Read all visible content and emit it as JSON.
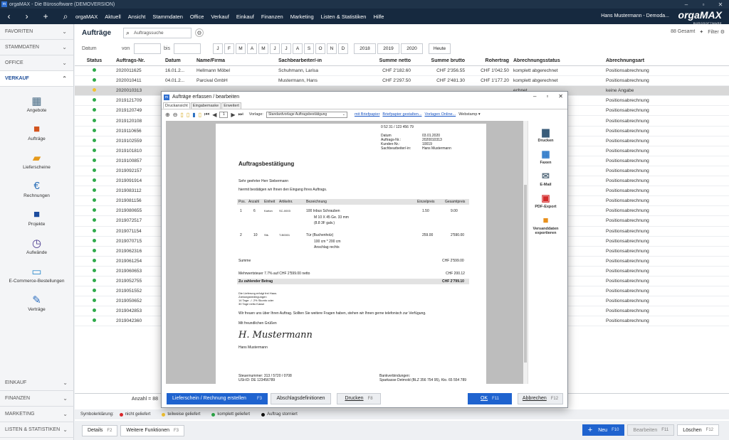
{
  "app": {
    "title": "orgaMAX - Die Bürosoftware (DEMOVERSION)",
    "logo_text": "orgaMAX",
    "logo_sub": "BÜROSOFTWARE",
    "user": "Hans Mustermann - Demoda..."
  },
  "menu": [
    "orgaMAX",
    "Aktuell",
    "Ansicht",
    "Stammdaten",
    "Office",
    "Verkauf",
    "Einkauf",
    "Finanzen",
    "Marketing",
    "Listen & Statistiken",
    "Hilfe"
  ],
  "sidebar": {
    "top_sections": [
      {
        "label": "FAVORITEN"
      },
      {
        "label": "STAMMDATEN"
      },
      {
        "label": "OFFICE"
      }
    ],
    "verkauf": "VERKAUF",
    "items": [
      {
        "label": "Angebote",
        "icon": "calculator-icon",
        "glyph": "▦",
        "color": "#4a6d86"
      },
      {
        "label": "Aufträge",
        "icon": "briefcase-icon",
        "glyph": "■",
        "color": "#d2541e"
      },
      {
        "label": "Lieferscheine",
        "icon": "truck-icon",
        "glyph": "▰",
        "color": "#e59a1c"
      },
      {
        "label": "Rechnungen",
        "icon": "invoice-icon",
        "glyph": "€",
        "color": "#2a6fb8"
      },
      {
        "label": "Projekte",
        "icon": "folder-icon",
        "glyph": "■",
        "color": "#1c4c9e"
      },
      {
        "label": "Aufwände",
        "icon": "clock-icon",
        "glyph": "◷",
        "color": "#4a3a8f"
      },
      {
        "label": "E-Commerce-Bestellungen",
        "icon": "laptop-icon",
        "glyph": "▭",
        "color": "#2c8acb"
      },
      {
        "label": "Verträge",
        "icon": "contract-icon",
        "glyph": "✎",
        "color": "#2f70c0"
      }
    ],
    "bottom_sections": [
      {
        "label": "EINKAUF"
      },
      {
        "label": "FINANZEN"
      },
      {
        "label": "MARKETING"
      },
      {
        "label": "LISTEN & STATISTIKEN"
      }
    ]
  },
  "main": {
    "title": "Aufträge",
    "search_placeholder": "Auftragssuche",
    "total": "88 Gesamt",
    "filter": "Filter",
    "date_label": "Datum",
    "from": "von",
    "to": "bis",
    "months": [
      "J",
      "F",
      "M",
      "A",
      "M",
      "J",
      "J",
      "A",
      "S",
      "O",
      "N",
      "D"
    ],
    "years": [
      "2018",
      "2019",
      "2020"
    ],
    "today": "Heute",
    "columns": [
      "Status",
      "Auftrags-Nr.",
      "Datum",
      "Name/Firma",
      "Sachbearbeiter/-in",
      "Summe netto",
      "Summe brutto",
      "Rohertrag",
      "Abrechnungsstatus",
      "Abrechnungsart"
    ],
    "rows": [
      {
        "status": "#2eaa4a",
        "nr": "2020011625",
        "datum": "16.01.2...",
        "name": "Hellmann Möbel",
        "sb": "Schuhmann, Larisa",
        "netto": "CHF 2'182.60",
        "brutto": "CHF 2'356.55",
        "roh": "CHF 1'042.50",
        "astatus": "komplett abgerechnet",
        "art": "Positionsabrechnung"
      },
      {
        "status": "#2eaa4a",
        "nr": "2020010411",
        "datum": "04.01.2...",
        "name": "Parcival GmbH",
        "sb": "Mustermann, Hans",
        "netto": "CHF 2'297.50",
        "brutto": "CHF 2'481.30",
        "roh": "CHF 1'177.20",
        "astatus": "komplett abgerechnet",
        "art": "Positionsabrechnung"
      },
      {
        "status": "#f2c230",
        "nr": "2020010313",
        "datum": "",
        "name": "",
        "sb": "",
        "netto": "",
        "brutto": "",
        "roh": "",
        "astatus": "echnet",
        "art": "keine Angabe"
      },
      {
        "status": "#2eaa4a",
        "nr": "2019121709",
        "astatus": "echnet",
        "art": "Positionsabrechnung"
      },
      {
        "status": "#2eaa4a",
        "nr": "2019120749",
        "astatus": "echnet",
        "art": "Positionsabrechnung"
      },
      {
        "status": "#2eaa4a",
        "nr": "2019120108",
        "astatus": "echnet",
        "art": "Positionsabrechnung"
      },
      {
        "status": "#2eaa4a",
        "nr": "2019110656",
        "astatus": "echnet",
        "art": "Positionsabrechnung"
      },
      {
        "status": "#2eaa4a",
        "nr": "2019102559",
        "astatus": "echnet",
        "art": "Positionsabrechnung"
      },
      {
        "status": "#2eaa4a",
        "nr": "2019101810",
        "astatus": "echnet",
        "art": "Positionsabrechnung"
      },
      {
        "status": "#2eaa4a",
        "nr": "2019100857",
        "astatus": "echnet",
        "art": "Positionsabrechnung"
      },
      {
        "status": "#2eaa4a",
        "nr": "2019092157",
        "astatus": "echnet",
        "art": "Positionsabrechnung"
      },
      {
        "status": "#2eaa4a",
        "nr": "2019091914",
        "astatus": "echnet",
        "art": "Positionsabrechnung"
      },
      {
        "status": "#2eaa4a",
        "nr": "2019083112",
        "astatus": "echnet",
        "art": "Positionsabrechnung"
      },
      {
        "status": "#2eaa4a",
        "nr": "2019081156",
        "astatus": "echnet",
        "art": "Positionsabrechnung"
      },
      {
        "status": "#2eaa4a",
        "nr": "2019080655",
        "astatus": "echnet",
        "art": "Positionsabrechnung"
      },
      {
        "status": "#2eaa4a",
        "nr": "2019072517",
        "astatus": "echnet",
        "art": "Positionsabrechnung"
      },
      {
        "status": "#2eaa4a",
        "nr": "2019071154",
        "astatus": "echnet",
        "art": "Positionsabrechnung"
      },
      {
        "status": "#2eaa4a",
        "nr": "2019070715",
        "astatus": "echnet",
        "art": "Positionsabrechnung"
      },
      {
        "status": "#2eaa4a",
        "nr": "2019062316",
        "astatus": "echnet",
        "art": "Positionsabrechnung"
      },
      {
        "status": "#2eaa4a",
        "nr": "2019061254",
        "astatus": "echnet",
        "art": "Positionsabrechnung"
      },
      {
        "status": "#2eaa4a",
        "nr": "2019060653",
        "astatus": "echnet",
        "art": "Positionsabrechnung"
      },
      {
        "status": "#2eaa4a",
        "nr": "2019052755",
        "astatus": "echnet",
        "art": "Positionsabrechnung"
      },
      {
        "status": "#2eaa4a",
        "nr": "2019051552",
        "astatus": "echnet",
        "art": "Positionsabrechnung"
      },
      {
        "status": "#2eaa4a",
        "nr": "2019050652",
        "astatus": "echnet",
        "art": "Positionsabrechnung"
      },
      {
        "status": "#2eaa4a",
        "nr": "2019042853",
        "astatus": "echnet",
        "art": "Positionsabrechnung"
      },
      {
        "status": "#2eaa4a",
        "nr": "2019042360",
        "astatus": "echnet",
        "art": "Positionsabrechnung"
      }
    ],
    "anzahl": "Anzahl = 88"
  },
  "symbols": {
    "label": "Symbolerklärung:",
    "items": [
      {
        "color": "#d8262a",
        "text": "nicht geliefert"
      },
      {
        "color": "#f2c230",
        "text": "teilweise geliefert"
      },
      {
        "color": "#2eaa4a",
        "text": "komplett geliefert"
      },
      {
        "color": "#111111",
        "text": "Auftrag storniert"
      }
    ]
  },
  "footer": {
    "details": "Details",
    "details_key": "F2",
    "weitere": "Weitere Funktionen",
    "weitere_key": "F3",
    "neu": "Neu",
    "neu_key": "F10",
    "bearbeiten": "Bearbeiten",
    "bearbeiten_key": "F11",
    "loeschen": "Löschen",
    "loeschen_key": "F12"
  },
  "dialog": {
    "title": "Aufträge erfassen / bearbeiten",
    "tabs": [
      "Druckansicht",
      "Eingabemaske",
      "Erweitert"
    ],
    "page_num": "1",
    "vorlage_label": "Vorlage:",
    "vorlage_value": "Standardvorlage Auftragsbestätigung",
    "links": [
      "mit Briefpapier",
      "Briefpapier gestalten...",
      "Vorlagen Online..."
    ],
    "webstamp": "Webstamp",
    "actions": [
      {
        "label": "Drucken",
        "icon": "printer-icon",
        "glyph": "▆",
        "color": "#3a5d7a"
      },
      {
        "label": "Faxen",
        "icon": "fax-icon",
        "glyph": "▦",
        "color": "#2b78c8"
      },
      {
        "label": "E-Mail",
        "icon": "mail-icon",
        "glyph": "✉",
        "color": "#5a6f80"
      },
      {
        "label": "PDF-Export",
        "icon": "pdf-icon",
        "glyph": "▣",
        "color": "#d32a2a"
      },
      {
        "label": "Versanddaten exportieren",
        "icon": "export-icon",
        "glyph": "■",
        "color": "#e8901c"
      }
    ],
    "buttons": {
      "lieferschein": "Lieferschein / Rechnung erstellen",
      "lieferschein_key": "F3",
      "abschlag": "Abschlagsdefinitionen",
      "drucken": "Drucken",
      "drucken_key": "F8",
      "ok": "OK",
      "ok_key": "F11",
      "abbrechen": "Abbrechen",
      "abbrechen_key": "F12"
    }
  },
  "doc": {
    "phone": "0 52 31 / 123 456 79",
    "meta": [
      [
        "Datum",
        "03.01.2020"
      ],
      [
        "Auftrags-Nr.:",
        "2020010313"
      ],
      [
        "Kunden-Nr.:",
        "10019"
      ],
      [
        "Sachbearbeiter/-in:",
        "Hans Mustermann"
      ]
    ],
    "heading": "Auftragsbestätigung",
    "salutation": "Sehr geehrter Herr Siebermann",
    "intro": "hiermit bestätigen wir Ihnen den Eingang Ihres Auftrags.",
    "cols": [
      "Pos.",
      "Anzahl",
      "Einheit",
      "Artikelnr.",
      "Bezeichnung",
      "Einzelpreis",
      "Gesamtpreis"
    ],
    "lines": [
      {
        "pos": "1",
        "anz": "6",
        "ein": "Karton",
        "art": "SC-0003",
        "bez": "100 Inbus Schrauben",
        "sub": [
          "M 10 X 45 Ge. 33 mm",
          "(8.8 3F galv.)"
        ],
        "ep": "1.50",
        "gp": "9.00"
      },
      {
        "pos": "2",
        "anz": "10",
        "ein": "Stk.",
        "art": "T-B0001",
        "bez": "Tür (Buchenholz)",
        "sub": [
          "100 cm * 200 cm",
          "Anschlag rechts"
        ],
        "ep": "259.00",
        "gp": "2'590.00"
      }
    ],
    "summe_label": "Summe",
    "summe": "CHF 2'599.00",
    "mwst_label": "Mehrwertsteuer 7.7% auf CHF 2'599.00 netto",
    "mwst": "CHF 200.12",
    "total_label": "Zu zahlender Betrag",
    "total": "CHF 2'799.10",
    "terms": [
      "Die Lieferung erfolgt frei Haus.",
      "Zahlungsbedingungen",
      "14 Tage: ./. 2% Skonto oder",
      "30 Tage netto Kasse"
    ],
    "thanks": "Wir freuen uns über Ihren Auftrag.  Sollten Sie weitere Fragen haben, stehen wir Ihnen gerne telefonisch zur Verfügung.",
    "greeting": "Mit freundlichen Grüßen",
    "signature": "H. Mustermann",
    "signer": "Hans Mustermann",
    "foot_left": [
      "Steuernummer: 313 / 5720 / 0708",
      "USt-ID: DE 123456789"
    ],
    "foot_right": [
      "Bankverbindungen:",
      "Sparkasse Detmold (BLZ 356 754 95), Kto. 65 554 789"
    ]
  }
}
